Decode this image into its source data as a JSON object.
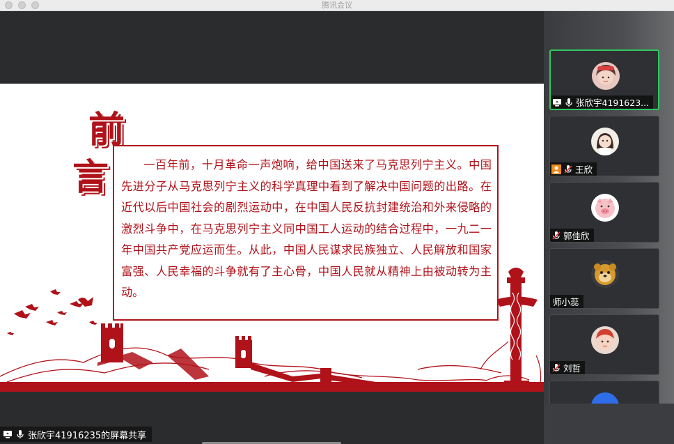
{
  "window": {
    "title": "腾讯会议"
  },
  "slide": {
    "heading": [
      "前",
      "言"
    ],
    "paragraph": "一百年前，十月革命一声炮响，给中国送来了马克思列宁主义。中国先进分子从马克思列宁主义的科学真理中看到了解决中国问题的出路。在近代以后中国社会的剧烈运动中，在中国人民反抗封建统治和外来侵略的激烈斗争中，在马克思列宁主义同中国工人运动的结合过程中，一九二一年中国共产党应运而生。从此，中国人民谋求民族独立、人民解放和国家富强、人民幸福的斗争就有了主心骨，中国人民就从精神上由被动转为主动。"
  },
  "share_label": "张欣宇41916235的屏幕共享",
  "participants": [
    {
      "name": "张欣宇4191623...",
      "status": "screen-share + mic-on",
      "active": true
    },
    {
      "name": "王欣",
      "status": "host + mic-muted",
      "active": false
    },
    {
      "name": "郭佳欣",
      "status": "mic-muted",
      "active": false
    },
    {
      "name": "师小蕊",
      "status": "none",
      "active": false
    },
    {
      "name": "刘哲",
      "status": "mic-muted",
      "active": false
    }
  ],
  "colors": {
    "accent_red": "#b0121a",
    "active_border": "#2fc862",
    "host_badge": "#f08a1c"
  }
}
